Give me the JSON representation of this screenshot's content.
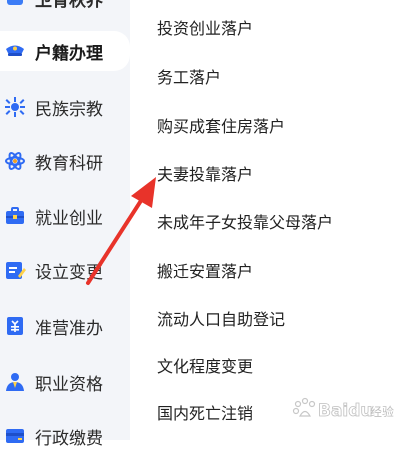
{
  "sidebar": {
    "items": [
      {
        "label": "卫育秋养",
        "icon": "top-partial-icon"
      },
      {
        "label": "户籍办理",
        "icon": "police-cap-icon"
      },
      {
        "label": "民族宗教",
        "icon": "sun-flower-icon"
      },
      {
        "label": "教育科研",
        "icon": "atom-icon"
      },
      {
        "label": "就业创业",
        "icon": "briefcase-icon"
      },
      {
        "label": "设立变更",
        "icon": "edit-document-icon"
      },
      {
        "label": "准营准办",
        "icon": "license-doc-icon"
      },
      {
        "label": "职业资格",
        "icon": "person-certificate-icon"
      },
      {
        "label": "行政缴费",
        "icon": "payment-card-icon"
      }
    ],
    "selected_index": 1
  },
  "list": {
    "items": [
      "投资创业落户",
      "务工落户",
      "购买成套住房落户",
      "夫妻投靠落户",
      "未成年子女投靠父母落户",
      "搬迁安置落户",
      "流动人口自助登记",
      "文化程度变更",
      "国内死亡注销"
    ]
  },
  "annotation": {
    "arrow_color": "#e8332a",
    "points_to": "夫妻投靠落户"
  },
  "watermark": {
    "text": "Baidu 经验"
  },
  "colors": {
    "accent": "#2f6bf3",
    "sidebar_bg": "#f3f5f9"
  }
}
